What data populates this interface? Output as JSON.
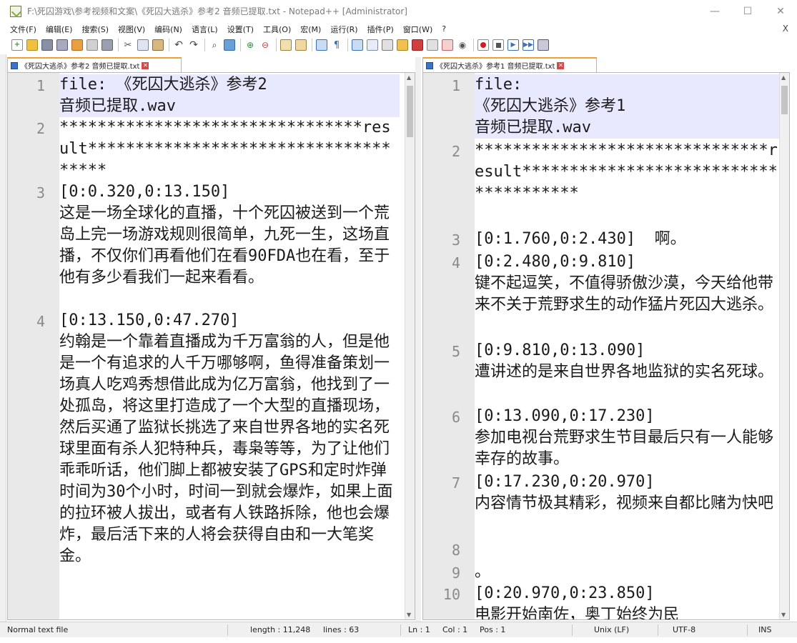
{
  "window": {
    "title": "F:\\死囚游戏\\参考视频和文案\\《死囚大逃杀》参考2 音频已提取.txt - Notepad++ [Administrator]",
    "min_glyph": "—",
    "max_glyph": "☐",
    "close_glyph": "✕"
  },
  "menu": {
    "items": [
      "文件(F)",
      "编辑(E)",
      "搜索(S)",
      "视图(V)",
      "编码(N)",
      "语言(L)",
      "设置(T)",
      "工具(O)",
      "宏(M)",
      "运行(R)",
      "插件(P)",
      "窗口(W)",
      "?"
    ],
    "close_glyph": "X"
  },
  "toolbar": {
    "icons": [
      "new-file-icon",
      "open-file-icon",
      "save-icon",
      "save-all-icon",
      "close-icon",
      "close-all-icon",
      "print-icon",
      "cut-icon",
      "copy-icon",
      "paste-icon",
      "undo-icon",
      "redo-icon",
      "find-icon",
      "replace-icon",
      "zoom-in-icon",
      "zoom-out-icon",
      "sync-vertical-icon",
      "sync-horizontal-icon",
      "word-wrap-icon",
      "show-all-chars-icon",
      "indent-guide-icon",
      "doc-map-icon",
      "function-list-icon",
      "folder-workspace-icon",
      "doc-switcher-icon",
      "monitor-icon",
      "record-macro-icon",
      "stop-macro-icon",
      "play-macro-icon",
      "run-macro-multiple-icon",
      "save-macro-icon"
    ]
  },
  "tabs": {
    "left": {
      "label": "《死囚大逃杀》参考2 音频已提取.txt"
    },
    "right": {
      "label": "《死囚大逃杀》参考1 音频已提取.txt"
    }
  },
  "left_pane": {
    "lines": [
      {
        "num": "1",
        "text": "file: 《死囚大逃杀》参考2\n音频已提取.wav",
        "highlight": true
      },
      {
        "num": "2",
        "text": "********************************result*************************************"
      },
      {
        "num": "3",
        "text": "[0:0.320,0:13.150]\n这是一场全球化的直播，十个死囚被送到一个荒岛上完一场游戏规则很简单，九死一生，这场直播，不仅你们再看他们在看90FDA也在看，至于他有多少看我们一起来看看。"
      },
      {
        "num": "4",
        "text": "[0:13.150,0:47.270]\n约翰是一个靠着直播成为千万富翁的人，但是他是一个有追求的人千万哪够啊，鱼得准备策划一场真人吃鸡秀想借此成为亿万富翁，他找到了一处孤岛，将这里打造成了一个大型的直播现场，然后买通了监狱长挑选了来自世界各地的实名死球里面有杀人犯特种兵，毒枭等等，为了让他们乖乖听话，他们脚上都被安装了GPS和定时炸弹时间为30个小时，时间一到就会爆炸，如果上面的拉环被人拔出，或者有人铁路拆除，他也会爆炸，最后活下来的人将会获得自由和一大笔奖金。"
      }
    ]
  },
  "right_pane": {
    "lines": [
      {
        "num": "1",
        "text": "file:\n《死囚大逃杀》参考1\n音频已提取.wav",
        "highlight": true
      },
      {
        "num": "2",
        "text": "*******************************result**************************************"
      },
      {
        "num": "3",
        "text": "[0:1.760,0:2.430]  啊。"
      },
      {
        "num": "4",
        "text": "[0:2.480,0:9.810]\n键不起逗笑，不值得骄傲沙漠，今天给他带来不关于荒野求生的动作猛片死囚大逃杀。"
      },
      {
        "num": "5",
        "text": "[0:9.810,0:13.090]\n遭讲述的是来自世界各地监狱的实名死球。"
      },
      {
        "num": "6",
        "text": "[0:13.090,0:17.230]\n参加电视台荒野求生节目最后只有一人能够幸存的故事。"
      },
      {
        "num": "7",
        "text": "[0:17.230,0:20.970]\n内容情节极其精彩，视频来自都比赌为快吧"
      },
      {
        "num": "8",
        "text": ""
      },
      {
        "num": "9",
        "text": "。"
      },
      {
        "num": "10",
        "text": "[0:20.970,0:23.850]\n电影开始南佐，奥丁始终为民"
      }
    ]
  },
  "status": {
    "file_type": "Normal text file",
    "length": "length : 11,248",
    "lines": "lines : 63",
    "ln": "Ln : 1",
    "col": "Col : 1",
    "pos": "Pos : 1",
    "eol": "Unix (LF)",
    "encoding": "UTF-8",
    "mode": "INS"
  }
}
